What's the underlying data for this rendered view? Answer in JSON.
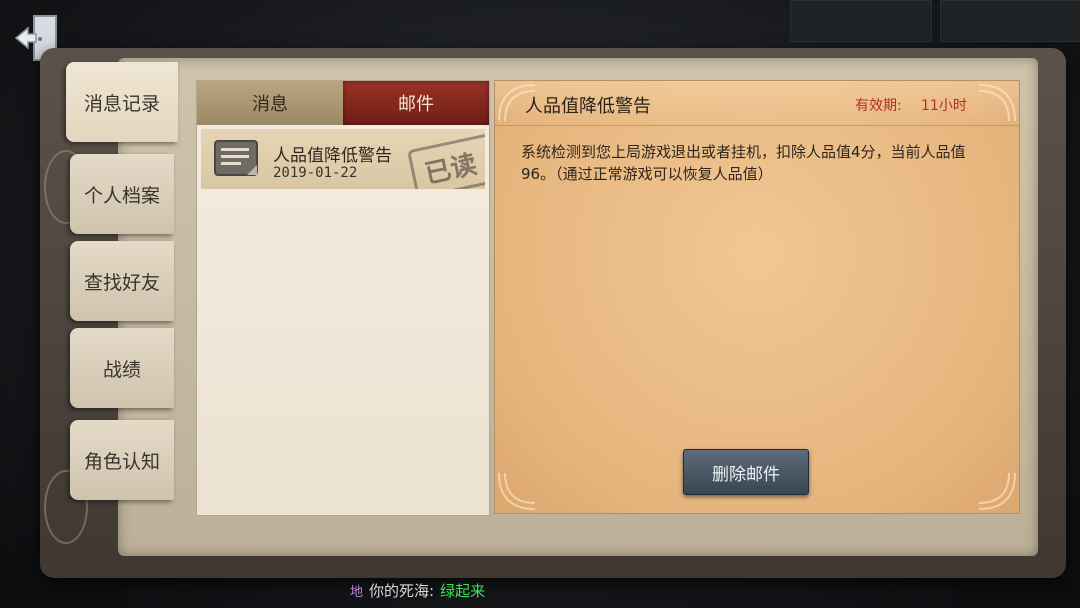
{
  "side_tabs": [
    {
      "label": "消息记录"
    },
    {
      "label": "个人档案"
    },
    {
      "label": "查找好友"
    },
    {
      "label": "战绩"
    },
    {
      "label": "角色认知"
    }
  ],
  "list_tabs": {
    "message": "消息",
    "mail": "邮件"
  },
  "mail_item": {
    "title": "人品值降低警告",
    "date": "2019-01-22",
    "stamp": "已读"
  },
  "detail": {
    "title": "人品值降低警告",
    "expiry_label": "有效期:",
    "expiry_value": "11小时",
    "body": "系统检测到您上局游戏退出或者挂机，扣除人品值4分，当前人品值96。（通过正常游戏可以恢复人品值）",
    "delete_button": "删除邮件"
  },
  "chat": {
    "channel": "地",
    "sender": "你的死海:",
    "message": "绿起来"
  },
  "colors": {
    "accent_red": "#9b3226",
    "expiry_red": "#b0322a",
    "chat_green": "#3ee05a",
    "button_slate": "#4b5866"
  },
  "icons": {
    "back": "exit-door-icon",
    "mail": "mail-document-icon"
  }
}
